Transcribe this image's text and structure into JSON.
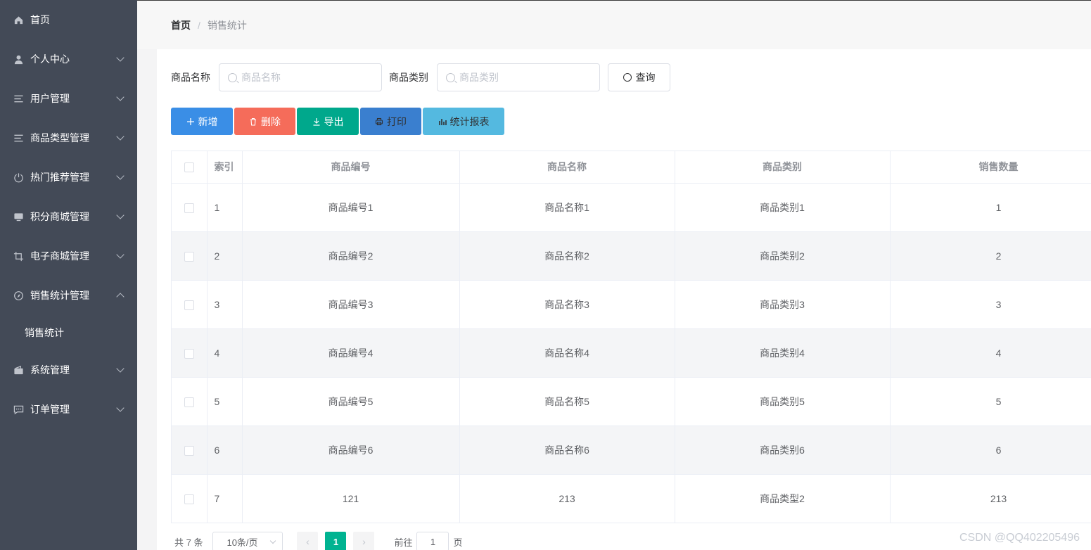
{
  "sidebar": {
    "items": [
      {
        "label": "首页",
        "icon": "home-icon",
        "has_arrow": false
      },
      {
        "label": "个人中心",
        "icon": "user-icon",
        "has_arrow": true
      },
      {
        "label": "用户管理",
        "icon": "list-icon",
        "has_arrow": true
      },
      {
        "label": "商品类型管理",
        "icon": "list-icon",
        "has_arrow": true
      },
      {
        "label": "热门推荐管理",
        "icon": "power-icon",
        "has_arrow": true
      },
      {
        "label": "积分商城管理",
        "icon": "monitor-icon",
        "has_arrow": true
      },
      {
        "label": "电子商城管理",
        "icon": "crop-icon",
        "has_arrow": true
      },
      {
        "label": "销售统计管理",
        "icon": "compass-icon",
        "has_arrow": true,
        "expanded": true
      }
    ],
    "submenu": {
      "label": "销售统计"
    },
    "items_after": [
      {
        "label": "系统管理",
        "icon": "wallet-icon",
        "has_arrow": true
      },
      {
        "label": "订单管理",
        "icon": "chat-icon",
        "has_arrow": true
      }
    ]
  },
  "breadcrumb": {
    "home": "首页",
    "separator": "/",
    "current": "销售统计"
  },
  "search": {
    "name_label": "商品名称",
    "name_placeholder": "商品名称",
    "category_label": "商品类别",
    "category_placeholder": "商品类别",
    "query_button": "查询"
  },
  "actions": {
    "add": "新增",
    "delete": "删除",
    "export": "导出",
    "print": "打印",
    "report": "统计报表"
  },
  "colors": {
    "sidebar_bg": "#434a57",
    "add": "#3a8ee6",
    "delete": "#f56c5a",
    "export": "#00a88c",
    "print": "#3a7fcf",
    "report": "#54b9e0",
    "page_active": "#00b391"
  },
  "table": {
    "headers": [
      "索引",
      "商品编号",
      "商品名称",
      "商品类别",
      "销售数量"
    ],
    "rows": [
      [
        "1",
        "商品编号1",
        "商品名称1",
        "商品类别1",
        "1"
      ],
      [
        "2",
        "商品编号2",
        "商品名称2",
        "商品类别2",
        "2"
      ],
      [
        "3",
        "商品编号3",
        "商品名称3",
        "商品类别3",
        "3"
      ],
      [
        "4",
        "商品编号4",
        "商品名称4",
        "商品类别4",
        "4"
      ],
      [
        "5",
        "商品编号5",
        "商品名称5",
        "商品类别5",
        "5"
      ],
      [
        "6",
        "商品编号6",
        "商品名称6",
        "商品类别6",
        "6"
      ],
      [
        "7",
        "121",
        "213",
        "商品类型2",
        "213"
      ]
    ]
  },
  "pagination": {
    "total": "共 7 条",
    "page_size": "10条/页",
    "current_page": "1",
    "goto_prefix": "前往",
    "goto_value": "1",
    "goto_suffix": "页",
    "prev": "‹",
    "next": "›"
  },
  "watermark": "CSDN @QQ402205496"
}
